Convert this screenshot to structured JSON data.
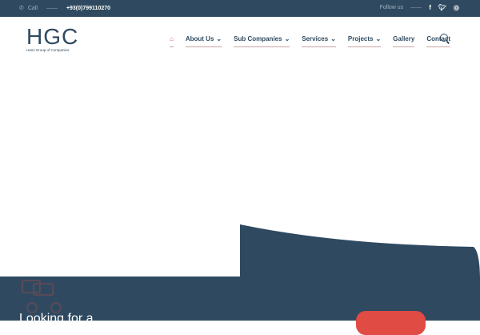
{
  "topbar": {
    "call_label": "Call",
    "phone": "+93(0)799110270",
    "follow_label": "Follow us",
    "social": [
      "f",
      "t",
      "ig"
    ]
  },
  "logo": {
    "title": "HGC",
    "subtitle": "Hami Group of Companies"
  },
  "nav": {
    "items": [
      "About Us",
      "Sub Companies",
      "Services",
      "Projects",
      "Gallery",
      "Contact"
    ]
  },
  "cta": {
    "text": "Looking for a"
  },
  "colors": {
    "primary": "#2f4a60",
    "accent": "#e04b43"
  }
}
